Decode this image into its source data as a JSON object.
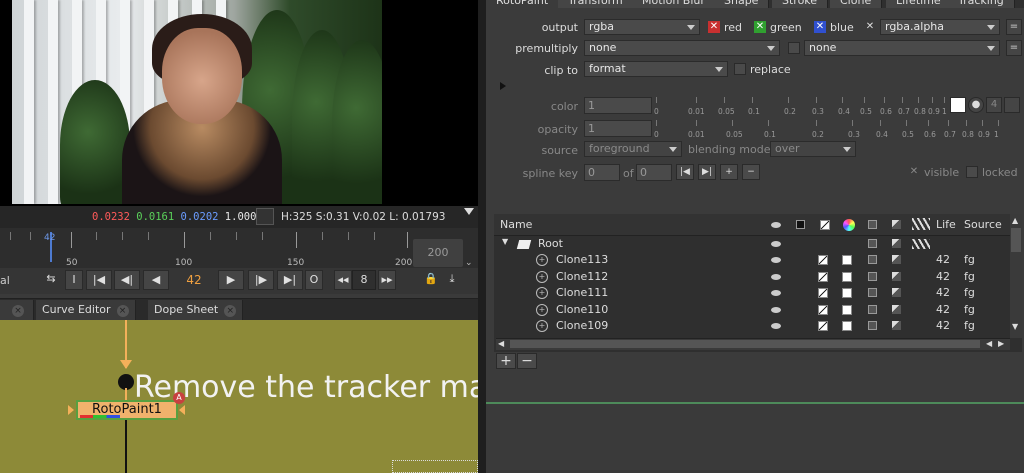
{
  "viewer": {
    "r": "0.0232",
    "g": "0.0161",
    "b": "0.0202",
    "a": "1.0000",
    "hsv": "H:325 S:0.31 V:0.02  L: 0.01793"
  },
  "timeline": {
    "playhead_label": "42",
    "ticks": [
      "50",
      "100",
      "150",
      "200"
    ],
    "end_frame": "200"
  },
  "transport": {
    "left_label": "al",
    "frame": "42",
    "step": "8",
    "btn_i": "I",
    "btn_o": "O"
  },
  "tabs": {
    "curve_editor": "Curve Editor",
    "dope_sheet": "Dope Sheet"
  },
  "nodegraph": {
    "annotation": "Remove the tracker ma",
    "node_label": "RotoPaint1",
    "node_badge": "A"
  },
  "props": {
    "tabs": [
      "RotoPaint",
      "Transform",
      "Motion Blur",
      "Shape",
      "Stroke",
      "Clone",
      "Lifetime",
      "Tracking"
    ],
    "output_label": "output",
    "output_value": "rgba",
    "red": "red",
    "green": "green",
    "blue": "blue",
    "alpha_value": "rgba.alpha",
    "premultiply_label": "premultiply",
    "premultiply_value": "none",
    "premultiply_value2": "none",
    "clipto_label": "clip to",
    "clipto_value": "format",
    "replace_label": "replace",
    "color_label": "color",
    "color_value": "1",
    "opacity_label": "opacity",
    "opacity_value": "1",
    "slider_ticks": [
      "0",
      "0.01",
      "0.05",
      "0.1",
      "0.2",
      "0.3",
      "0.4",
      "0.5",
      "0.6",
      "0.7",
      "0.8",
      "0.9",
      "1"
    ],
    "color_channels": "4",
    "source_label": "source",
    "source_value": "foreground",
    "blending_label": "blending mode",
    "blending_value": "over",
    "visible_label": "visible",
    "locked_label": "locked",
    "splinekey_label": "spline key",
    "splinekey_value": "0",
    "of_label": "of",
    "of_value": "0",
    "eq_btn": "="
  },
  "table": {
    "headers": {
      "name": "Name",
      "life": "Life",
      "source": "Source"
    },
    "root": "Root",
    "rows": [
      {
        "name": "Clone113",
        "life": "42",
        "source": "fg"
      },
      {
        "name": "Clone112",
        "life": "42",
        "source": "fg"
      },
      {
        "name": "Clone111",
        "life": "42",
        "source": "fg"
      },
      {
        "name": "Clone110",
        "life": "42",
        "source": "fg"
      },
      {
        "name": "Clone109",
        "life": "42",
        "source": "fg"
      }
    ],
    "add": "+",
    "remove": "−"
  }
}
